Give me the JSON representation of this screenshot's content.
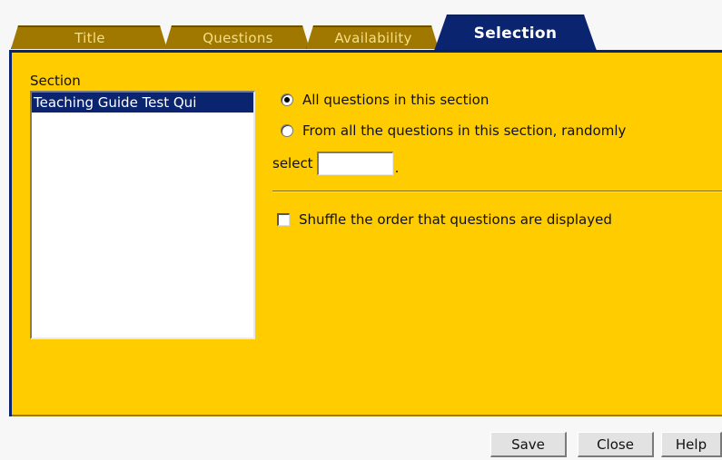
{
  "tabs": {
    "title": "Title",
    "questions": "Questions",
    "availability": "Availability",
    "selection": "Selection",
    "active": "Selection"
  },
  "section": {
    "label": "Section",
    "items": [
      "Teaching Guide Test Qui"
    ],
    "selected_index": 0
  },
  "options": {
    "all_questions_label": "All questions in this section",
    "all_questions_checked": true,
    "random_label": "From all the questions in this section, randomly",
    "random_checked": false,
    "select_label": "select",
    "select_value": "",
    "select_suffix": ".",
    "shuffle_label": "Shuffle the order that questions are displayed",
    "shuffle_checked": false
  },
  "buttons": {
    "save": "Save",
    "close": "Close",
    "help": "Help"
  },
  "colors": {
    "panel": "#ffcc00",
    "active_tab": "#0b2470",
    "inactive_tab": "#a07800",
    "inactive_tab_text": "#f6df86",
    "list_selected": "#0b2470",
    "button_face": "#e2e2e2"
  }
}
